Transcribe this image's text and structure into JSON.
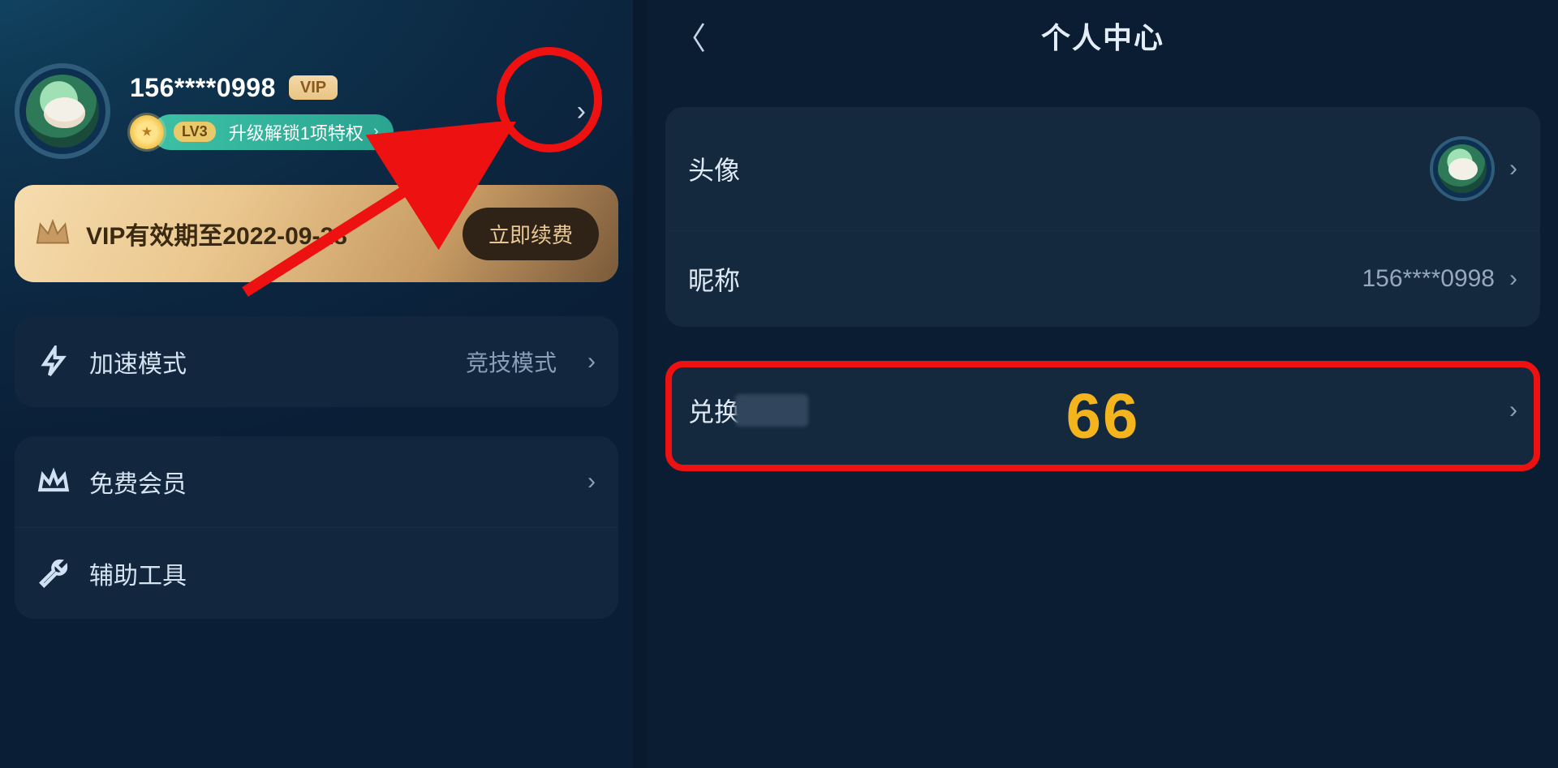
{
  "left": {
    "username": "156****0998",
    "vip_badge": "VIP",
    "level_tag": "LV3",
    "level_text": "升级解锁1项特权",
    "vip_bar_text": "VIP有效期至2022-09-28",
    "renew_label": "立即续费",
    "menu": {
      "accel_label": "加速模式",
      "accel_value": "竞技模式",
      "free_label": "免费会员",
      "tools_label": "辅助工具"
    }
  },
  "right": {
    "title": "个人中心",
    "avatar_label": "头像",
    "nickname_label": "昵称",
    "nickname_value": "156****0998",
    "code_label": "兑换码",
    "overlay_number": "66"
  }
}
